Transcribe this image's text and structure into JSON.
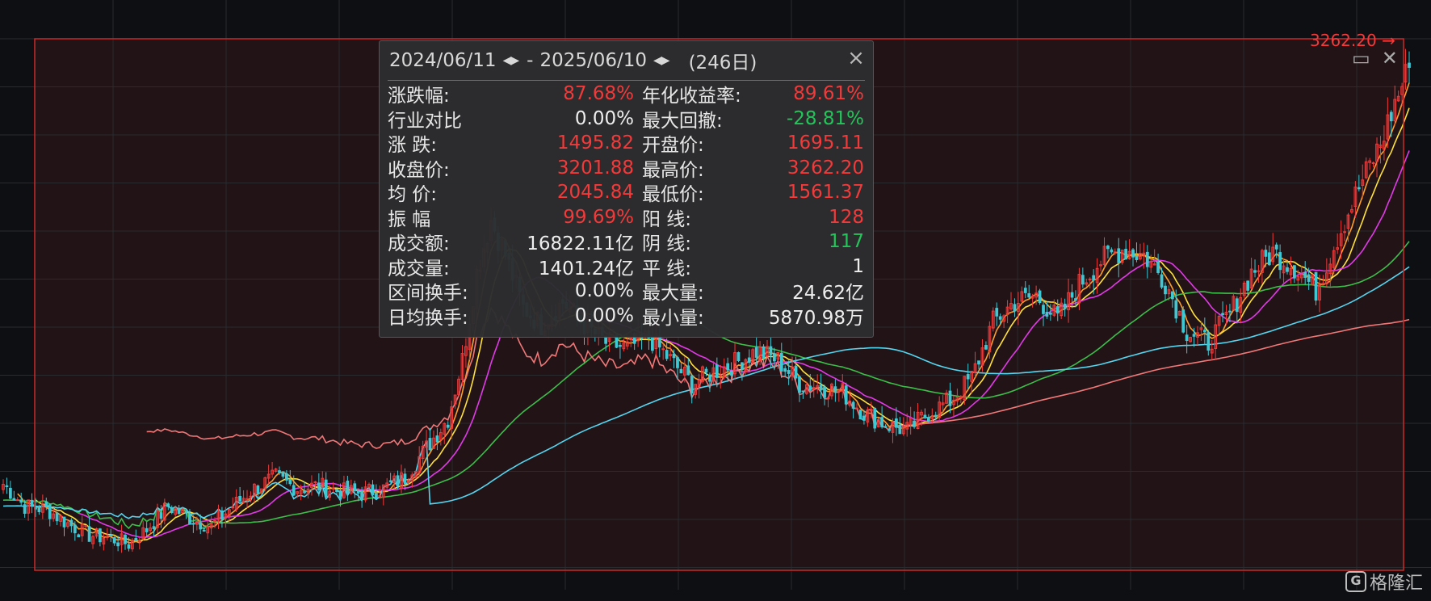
{
  "chart_data": {
    "type": "candlestick",
    "price_label": "3262.20",
    "ylim": [
      1480,
      3300
    ],
    "colors": {
      "up": "#f23a3a",
      "down": "#3fc8d4",
      "grid": "#2a2b2f",
      "frame": "#c92a2a",
      "selection_bg": "#221316"
    },
    "ma_colors": [
      "#ff9f2a",
      "#ffe23a",
      "#e23ae8",
      "#3cbf4a",
      "#55d6f0",
      "#f07878"
    ],
    "keypoints": [
      [
        0,
        1775
      ],
      [
        6,
        1700
      ],
      [
        12,
        1690
      ],
      [
        18,
        1640
      ],
      [
        24,
        1600
      ],
      [
        30,
        1590
      ],
      [
        35,
        1570
      ],
      [
        40,
        1620
      ],
      [
        46,
        1700
      ],
      [
        52,
        1660
      ],
      [
        58,
        1630
      ],
      [
        64,
        1700
      ],
      [
        70,
        1760
      ],
      [
        76,
        1800
      ],
      [
        82,
        1760
      ],
      [
        88,
        1770
      ],
      [
        94,
        1750
      ],
      [
        100,
        1745
      ],
      [
        106,
        1760
      ],
      [
        112,
        1800
      ],
      [
        118,
        1900
      ],
      [
        124,
        2000
      ],
      [
        128,
        2200
      ],
      [
        132,
        2500
      ],
      [
        136,
        2680
      ],
      [
        140,
        2560
      ],
      [
        145,
        2380
      ],
      [
        150,
        2320
      ],
      [
        156,
        2400
      ],
      [
        162,
        2320
      ],
      [
        168,
        2260
      ],
      [
        174,
        2240
      ],
      [
        180,
        2280
      ],
      [
        186,
        2200
      ],
      [
        192,
        2120
      ],
      [
        198,
        2160
      ],
      [
        204,
        2190
      ],
      [
        210,
        2230
      ],
      [
        216,
        2200
      ],
      [
        222,
        2120
      ],
      [
        228,
        2110
      ],
      [
        234,
        2090
      ],
      [
        240,
        2020
      ],
      [
        246,
        1980
      ],
      [
        252,
        1960
      ],
      [
        258,
        2020
      ],
      [
        264,
        2060
      ],
      [
        270,
        2140
      ],
      [
        276,
        2330
      ],
      [
        282,
        2400
      ],
      [
        288,
        2420
      ],
      [
        294,
        2340
      ],
      [
        300,
        2460
      ],
      [
        306,
        2540
      ],
      [
        312,
        2580
      ],
      [
        318,
        2560
      ],
      [
        324,
        2470
      ],
      [
        330,
        2300
      ],
      [
        336,
        2260
      ],
      [
        342,
        2360
      ],
      [
        348,
        2500
      ],
      [
        354,
        2570
      ],
      [
        360,
        2520
      ],
      [
        366,
        2440
      ],
      [
        372,
        2620
      ],
      [
        378,
        2790
      ],
      [
        384,
        2940
      ],
      [
        388,
        3080
      ],
      [
        392,
        3201.88
      ]
    ]
  },
  "selection": {
    "start_date": "2024/06/11",
    "end_date": "2025/06/10",
    "arrows": "◀▶",
    "dash": "-",
    "days": "(246日)"
  },
  "stats": [
    {
      "label": "涨跌幅:",
      "value": "87.68%",
      "color": "red",
      "label2": "年化收益率:",
      "value2": "89.61%",
      "color2": "red"
    },
    {
      "label": "行业对比",
      "value": "0.00%",
      "color": "white",
      "label2": "最大回撤:",
      "value2": "-28.81%",
      "color2": "green"
    },
    {
      "label": "涨  跌:",
      "value": "1495.82",
      "color": "red",
      "label2": "开盘价:",
      "value2": "1695.11",
      "color2": "red"
    },
    {
      "label": "收盘价:",
      "value": "3201.88",
      "color": "red",
      "label2": "最高价:",
      "value2": "3262.20",
      "color2": "red"
    },
    {
      "label": "均  价:",
      "value": "2045.84",
      "color": "red",
      "label2": "最低价:",
      "value2": "1561.37",
      "color2": "red"
    },
    {
      "label": "振  幅",
      "value": "99.69%",
      "color": "red",
      "label2": "阳  线:",
      "value2": "128",
      "color2": "red"
    },
    {
      "label": "成交额:",
      "value": "16822.11亿",
      "color": "white",
      "label2": "阴  线:",
      "value2": "117",
      "color2": "green"
    },
    {
      "label": "成交量:",
      "value": "1401.24亿",
      "color": "white",
      "label2": "平  线:",
      "value2": "1",
      "color2": "white"
    },
    {
      "label": "区间换手:",
      "value": "0.00%",
      "color": "white",
      "label2": "最大量:",
      "value2": "24.62亿",
      "color2": "white"
    },
    {
      "label": "日均换手:",
      "value": "0.00%",
      "color": "white",
      "label2": "最小量:",
      "value2": "5870.98万",
      "color2": "white"
    }
  ],
  "icons": {
    "close": "close-icon",
    "maximize": "maximize-icon",
    "close_chart": "close-chart-icon"
  },
  "watermark": "格隆汇"
}
